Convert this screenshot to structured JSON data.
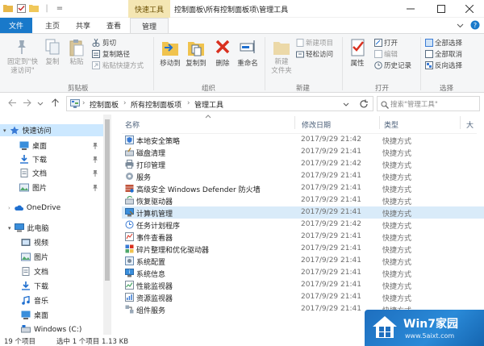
{
  "titlebar": {
    "contextual_tab": "快速工具",
    "title": "控制面板\\所有控制面板项\\管理工具",
    "qat_sep": "|",
    "qat_dropdown": "="
  },
  "tabs": [
    {
      "label": "文件"
    },
    {
      "label": "主页"
    },
    {
      "label": "共享"
    },
    {
      "label": "查看"
    },
    {
      "label": "管理"
    }
  ],
  "ribbon": {
    "clipboard": {
      "pin_label_1": "固定到\"快",
      "pin_label_2": "速访问\"",
      "copy": "复制",
      "paste": "粘贴",
      "cut": "剪切",
      "copy_path": "复制路径",
      "paste_shortcut": "粘贴快捷方式",
      "group": "剪贴板"
    },
    "organize": {
      "move_to": "移动到",
      "copy_to": "复制到",
      "delete": "删除",
      "rename": "重命名",
      "group": "组织"
    },
    "new": {
      "new_folder_1": "新建",
      "new_folder_2": "文件夹",
      "new_item": "新建项目",
      "easy_access": "轻松访问",
      "group": "新建"
    },
    "open": {
      "properties": "属性",
      "open": "打开",
      "edit": "编辑",
      "history": "历史记录",
      "group": "打开"
    },
    "select": {
      "select_all": "全部选择",
      "select_none": "全部取消",
      "invert": "反向选择",
      "group": "选择"
    }
  },
  "address": {
    "part1": "控制面板",
    "part2": "所有控制面板项",
    "part3": "管理工具",
    "sep": "›",
    "chevron": "›",
    "search_placeholder": "搜索\"管理工具\""
  },
  "nav_pane": {
    "items": [
      {
        "label": "快速访问"
      },
      {
        "label": "桌面"
      },
      {
        "label": "下载"
      },
      {
        "label": "文档"
      },
      {
        "label": "图片"
      },
      {
        "label": "OneDrive"
      },
      {
        "label": "此电脑"
      },
      {
        "label": "视频"
      },
      {
        "label": "图片"
      },
      {
        "label": "文档"
      },
      {
        "label": "下载"
      },
      {
        "label": "音乐"
      },
      {
        "label": "桌面"
      },
      {
        "label": "Windows (C:)"
      }
    ]
  },
  "columns": {
    "name": "名称",
    "date": "修改日期",
    "type": "类型",
    "size": "大"
  },
  "files": [
    {
      "name": "本地安全策略",
      "date": "2017/9/29 21:42",
      "type": "快捷方式"
    },
    {
      "name": "磁盘清理",
      "date": "2017/9/29 21:41",
      "type": "快捷方式"
    },
    {
      "name": "打印管理",
      "date": "2017/9/29 21:42",
      "type": "快捷方式"
    },
    {
      "name": "服务",
      "date": "2017/9/29 21:41",
      "type": "快捷方式"
    },
    {
      "name": "高级安全 Windows Defender 防火墙",
      "date": "2017/9/29 21:41",
      "type": "快捷方式"
    },
    {
      "name": "恢复驱动器",
      "date": "2017/9/29 21:41",
      "type": "快捷方式"
    },
    {
      "name": "计算机管理",
      "date": "2017/9/29 21:41",
      "type": "快捷方式"
    },
    {
      "name": "任务计划程序",
      "date": "2017/9/29 21:42",
      "type": "快捷方式"
    },
    {
      "name": "事件查看器",
      "date": "2017/9/29 21:41",
      "type": "快捷方式"
    },
    {
      "name": "碎片整理和优化驱动器",
      "date": "2017/9/29 21:41",
      "type": "快捷方式"
    },
    {
      "name": "系统配置",
      "date": "2017/9/29 21:41",
      "type": "快捷方式"
    },
    {
      "name": "系统信息",
      "date": "2017/9/29 21:41",
      "type": "快捷方式"
    },
    {
      "name": "性能监视器",
      "date": "2017/9/29 21:41",
      "type": "快捷方式"
    },
    {
      "name": "资源监视器",
      "date": "2017/9/29 21:41",
      "type": "快捷方式"
    },
    {
      "name": "组件服务",
      "date": "2017/9/29 21:41",
      "type": "快捷方式"
    }
  ],
  "status": {
    "count": "19 个项目",
    "selected": "选中 1 个项目  1.13 KB"
  },
  "watermark": {
    "brand": "Win7家园",
    "url": "www.5aixt.com"
  },
  "colors": {
    "file_tab": "#1979ca",
    "contextual_tab": "#f4e6b3",
    "selected_row": "#d9ebf9",
    "quick_access_selected": "#cce8ff"
  }
}
